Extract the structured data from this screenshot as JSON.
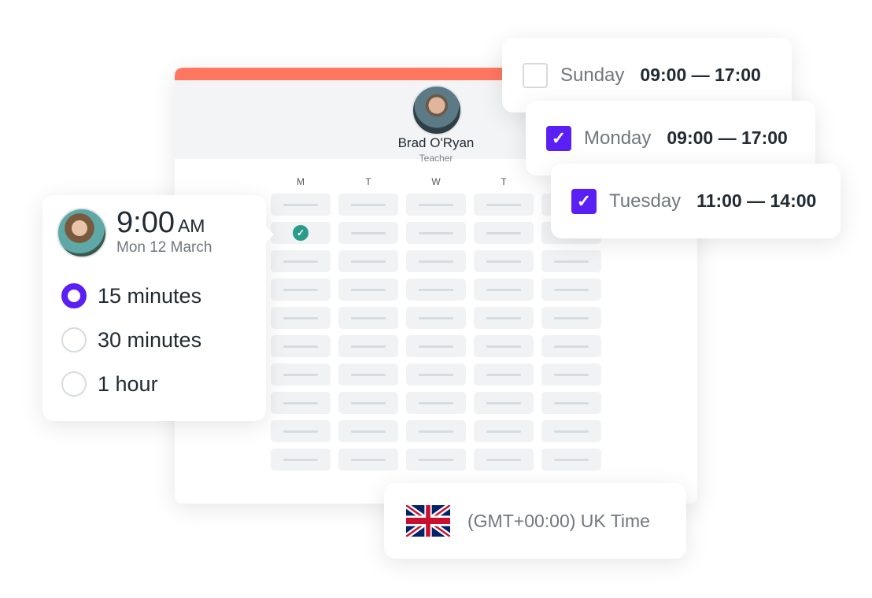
{
  "teacher": {
    "name": "Brad O'Ryan",
    "role": "Teacher"
  },
  "calendar": {
    "days": [
      "M",
      "T",
      "W",
      "T"
    ],
    "selected_slot": {
      "day": "M",
      "row": 2
    }
  },
  "booking": {
    "time": "9:00",
    "ampm": "AM",
    "date": "Mon 12 March",
    "durations": [
      {
        "label": "15 minutes",
        "selected": true
      },
      {
        "label": "30 minutes",
        "selected": false
      },
      {
        "label": "1 hour",
        "selected": false
      }
    ]
  },
  "availability": [
    {
      "day": "Sunday",
      "hours": "09:00 — 17:00",
      "checked": false
    },
    {
      "day": "Monday",
      "hours": "09:00 — 17:00",
      "checked": true
    },
    {
      "day": "Tuesday",
      "hours": "11:00 — 14:00",
      "checked": true
    }
  ],
  "timezone": {
    "label": "(GMT+00:00) UK Time",
    "flag": "uk-flag-icon"
  },
  "colors": {
    "accent": "#5a1ff5",
    "topbar": "#ff7761",
    "check": "#2a9d8a"
  }
}
